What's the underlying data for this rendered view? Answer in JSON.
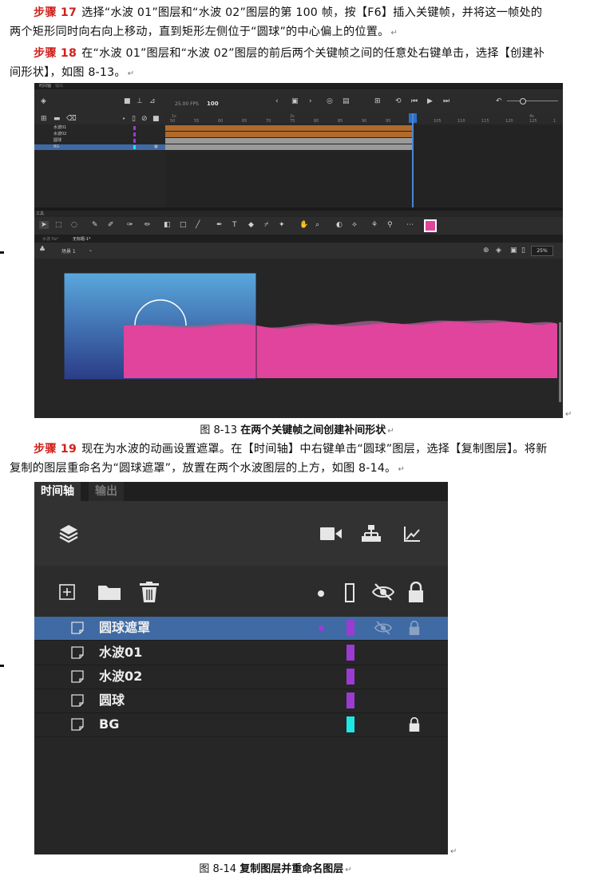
{
  "para1": {
    "step": "步骤 17",
    "text": "选择“水波 01”图层和“水波 02”图层的第 100 帧，按【F6】插入关键帧，并将这一帧处的两个矩形同时向右向上移动，直到矩形左侧位于“圆球”的中心偏上的位置。"
  },
  "para2": {
    "step": "步骤 18",
    "text": "在“水波 01”图层和“水波 02”图层的前后两个关键帧之间的任意处右键单击，选择【创建补间形状】，如图 8-13。"
  },
  "caption1": {
    "num": "图 8-13",
    "text": "在两个关键帧之间创建补间形状"
  },
  "para3": {
    "step": "步骤 19",
    "text": "现在为水波的动画设置遮罩。在【时间轴】中右键单击“圆球”图层，选择【复制图层】。将新复制的图层重命名为“圆球遮罩”，放置在两个水波图层的上方，如图 8-14。"
  },
  "caption2": {
    "num": "图 8-14",
    "text": "复制图层并重命名图层"
  },
  "return_mark": "↵",
  "shot1": {
    "tabs": [
      "时间轴",
      "输出"
    ],
    "fps": "25.00 FPS",
    "frame": "100",
    "layers": [
      {
        "name": "水波01",
        "color": "#9b3bd2"
      },
      {
        "name": "水波02",
        "color": "#9b3bd2"
      },
      {
        "name": "圆球",
        "color": "#9b3bd2"
      },
      {
        "name": "BG",
        "color": "#1ee6e6"
      }
    ],
    "ruler_top": [
      "1s",
      "2s",
      "3s",
      "4s"
    ],
    "ruler": [
      "50",
      "55",
      "60",
      "65",
      "70",
      "75",
      "80",
      "85",
      "90",
      "95",
      "100",
      "105",
      "110",
      "115",
      "120",
      "125",
      "1"
    ],
    "tools_label": "工具",
    "doc_tabs": [
      "水波.fla*",
      "无标题-1*"
    ],
    "scene": "场景 1",
    "zoom": "25%"
  },
  "shot2": {
    "tabs": {
      "timeline": "时间轴",
      "output": "输出"
    },
    "layers": [
      {
        "name": "圆球遮罩",
        "color": "#9b3bd2",
        "selected": true
      },
      {
        "name": "水波01",
        "color": "#9b3bd2"
      },
      {
        "name": "水波02",
        "color": "#9b3bd2"
      },
      {
        "name": "圆球",
        "color": "#9b3bd2"
      },
      {
        "name": "BG",
        "color": "#1ee6e6"
      }
    ]
  }
}
